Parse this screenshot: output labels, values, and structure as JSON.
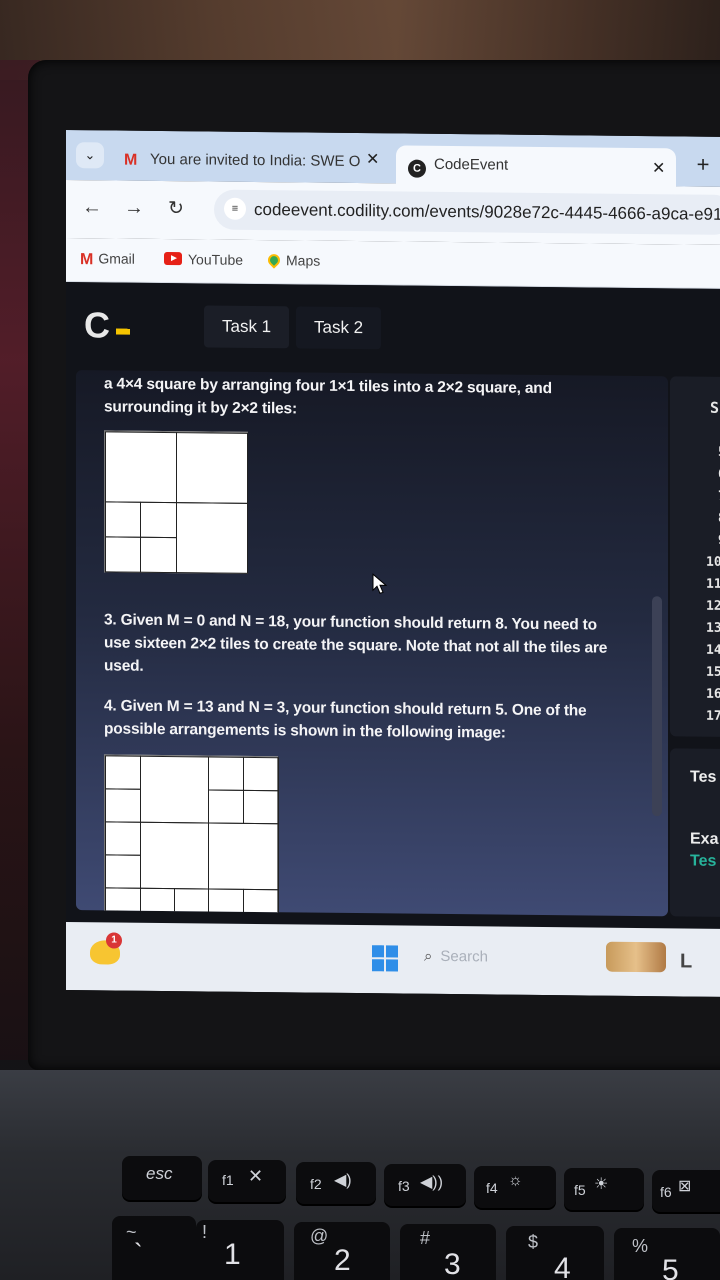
{
  "browser": {
    "tabs": [
      {
        "title": "You are invited to India: SWE O",
        "favicon": "gmail-icon"
      },
      {
        "title": "CodeEvent",
        "favicon": "codility-icon"
      }
    ],
    "url": "codeevent.codility.com/events/9028e72c-4445-4666-a9ca-e913",
    "bookmarks": [
      "Gmail",
      "YouTube",
      "Maps"
    ]
  },
  "app": {
    "logo": "C",
    "task_tabs": [
      "Task 1",
      "Task 2"
    ]
  },
  "description": {
    "para1": "a 4×4 square by arranging four 1×1 tiles into a 2×2 square, and surrounding it by 2×2 tiles:",
    "para2": "3. Given M = 0 and N = 18, your function should return 8. You need to use sixteen 2×2 tiles to create the square. Note that not all the tiles are used.",
    "para3": "4. Given M = 13 and N = 3, your function should return 5. One of the possible arrangements is shown in the following image:"
  },
  "editor": {
    "header_fragment": "S",
    "line_numbers": [
      "5",
      "6",
      "7",
      "8",
      "9",
      "10",
      "11",
      "12",
      "13",
      "14",
      "15",
      "16",
      "17"
    ]
  },
  "tests_panel": {
    "title_fragment": "Tes",
    "example_fragment": "Exa",
    "tests_fragment": "Tes"
  },
  "taskbar": {
    "search_placeholder": "Search",
    "notification_count": "1"
  },
  "keyboard": {
    "esc": "esc",
    "fkeys": [
      "f1",
      "f2",
      "f3",
      "f4",
      "f5",
      "f6"
    ],
    "numbers": [
      {
        "top": "~",
        "main": "`"
      },
      {
        "top": "!",
        "main": "1"
      },
      {
        "top": "@",
        "main": "2"
      },
      {
        "top": "#",
        "main": "3"
      },
      {
        "top": "$",
        "main": "4"
      },
      {
        "top": "%",
        "main": "5"
      }
    ]
  }
}
